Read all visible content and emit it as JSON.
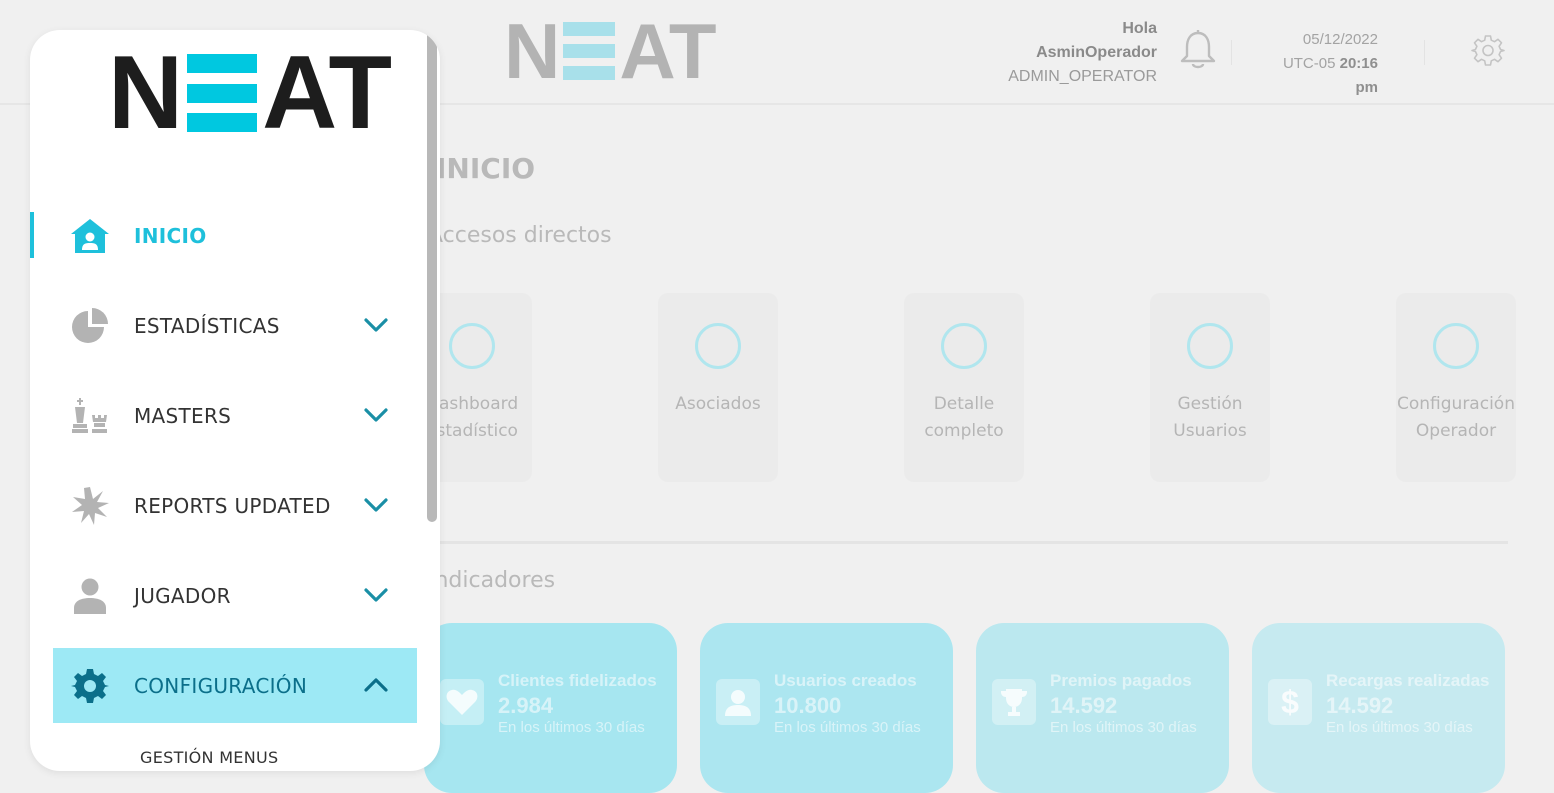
{
  "brand": {
    "logo_pre": "N",
    "logo_post": "AT"
  },
  "header": {
    "greeting": "Hola",
    "username": "AsminOperador",
    "role": "ADMIN_OPERATOR",
    "date": "05/12/2022",
    "timezone": "UTC-05",
    "time": "20:16 pm"
  },
  "main": {
    "title": "INICIO",
    "shortcuts_title": "Accesos directos",
    "shortcuts": [
      {
        "line1": "Dashboard",
        "line2": "estadístico"
      },
      {
        "line1": "Asociados",
        "line2": ""
      },
      {
        "line1": "Detalle",
        "line2": "completo"
      },
      {
        "line1": "Gestión",
        "line2": "Usuarios"
      },
      {
        "line1": "Configuración",
        "line2": "Operador"
      }
    ],
    "indicators_title": "Indicadores",
    "indicators": [
      {
        "title": "Clientes fidelizados",
        "value": "2.984",
        "sub": "En los últimos 30 días",
        "color": "#a6e6f0",
        "icon": "heart-icon"
      },
      {
        "title": "Usuarios creados",
        "value": "10.800",
        "sub": "En los últimos 30 días",
        "color": "#ace6f0",
        "icon": "user-icon"
      },
      {
        "title": "Premios pagados",
        "value": "14.592",
        "sub": "En los últimos 30 días",
        "color": "#bbe8ef",
        "icon": "trophy-icon"
      },
      {
        "title": "Recargas realizadas",
        "value": "14.592",
        "sub": "En los últimos 30 días",
        "color": "#c6eaf0",
        "icon": "dollar-icon"
      }
    ]
  },
  "sidebar": {
    "items": [
      {
        "label": "INICIO",
        "icon": "home-user-icon",
        "state": "active"
      },
      {
        "label": "ESTADÍSTICAS",
        "icon": "pie-chart-icon",
        "state": "collapsed"
      },
      {
        "label": "MASTERS",
        "icon": "chess-pieces-icon",
        "state": "collapsed"
      },
      {
        "label": "REPORTS UPDATED",
        "icon": "starburst-icon",
        "state": "collapsed"
      },
      {
        "label": "JUGADOR",
        "icon": "person-icon",
        "state": "collapsed"
      },
      {
        "label": "CONFIGURACIÓN",
        "icon": "gear-icon",
        "state": "expanded"
      }
    ],
    "subitems": [
      {
        "label": "GESTIÓN MENUS"
      }
    ]
  },
  "colors": {
    "accent": "#1ec0db",
    "accent_light": "#9de9f5",
    "accent_dark": "#0b6f8a",
    "background": "#f0f0f0"
  }
}
